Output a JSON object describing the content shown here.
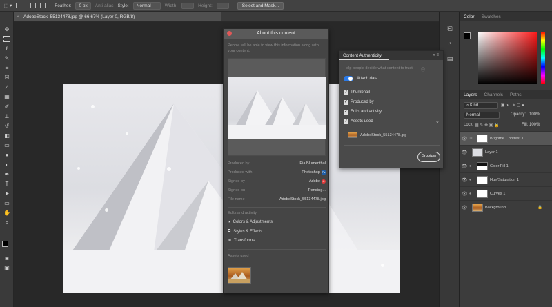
{
  "options_bar": {
    "feather_label": "Feather:",
    "feather_value": "0 px",
    "anti_alias": "Anti-alias",
    "style_label": "Style:",
    "style_value": "Normal",
    "width_label": "Width:",
    "height_label": "Height:",
    "select_mask": "Select and Mask..."
  },
  "document": {
    "tab_title": "AdobeStock_55134478.jpg @ 66.67% (Layer 0, RGB/8)",
    "close_glyph": "×"
  },
  "about": {
    "title": "About this content",
    "intro": "People will be able to view this information along with your content.",
    "rows": [
      {
        "key": "Produced by",
        "value": "Pia Blumenthal"
      },
      {
        "key": "Produced with",
        "value": "Photoshop"
      },
      {
        "key": "Signed by",
        "value": "Adobe"
      },
      {
        "key": "Signed on",
        "value": "Pending..."
      },
      {
        "key": "File name",
        "value": "AdobeStock_55134478.jpg"
      }
    ],
    "badges": {
      "photoshop": "Ps",
      "adobe": "A"
    },
    "edits_heading": "Edits and activity",
    "edits": [
      "Colors & Adjustments",
      "Styles & Effects",
      "Transforms"
    ],
    "assets_heading": "Assets used"
  },
  "content_authenticity": {
    "tab": "Content Authenticity",
    "help": "Help people decide what content to trust",
    "attach": "Attach data",
    "attach_on": true,
    "items": [
      "Thumbnail",
      "Produced by",
      "Edits and activity",
      "Assets used"
    ],
    "asset_file": "AdobeStock_55134478.jpg",
    "preview_button": "Preview"
  },
  "color_panel": {
    "tabs": [
      "Color",
      "Swatches"
    ],
    "hue_color": "#ff1a1a"
  },
  "layers_panel": {
    "tabs": [
      "Layers",
      "Channels",
      "Paths"
    ],
    "filter": "Kind",
    "blend_mode": "Normal",
    "opacity_label": "Opacity:",
    "opacity_value": "100%",
    "lock_label": "Lock:",
    "fill_label": "Fill:",
    "fill_value": "100%",
    "layers": [
      {
        "name": "Brightne... ontrast 1",
        "selected": true
      },
      {
        "name": "Layer 1",
        "selected": false
      },
      {
        "name": "Color Fill 1",
        "selected": false
      },
      {
        "name": "Hue/Saturation 1",
        "selected": false
      },
      {
        "name": "Curves 1",
        "selected": false
      },
      {
        "name": "Background",
        "selected": false
      }
    ]
  },
  "icons": {
    "tools": [
      "move-icon",
      "marquee-icon",
      "lasso-icon",
      "quick-select-icon",
      "crop-icon",
      "frame-icon",
      "eyedropper-icon",
      "healing-icon",
      "brush-icon",
      "stamp-icon",
      "history-brush-icon",
      "eraser-icon",
      "gradient-icon",
      "blur-icon",
      "dodge-icon",
      "pen-icon",
      "type-icon",
      "path-select-icon",
      "shape-icon",
      "hand-icon",
      "zoom-icon",
      "more-tools-icon"
    ]
  }
}
